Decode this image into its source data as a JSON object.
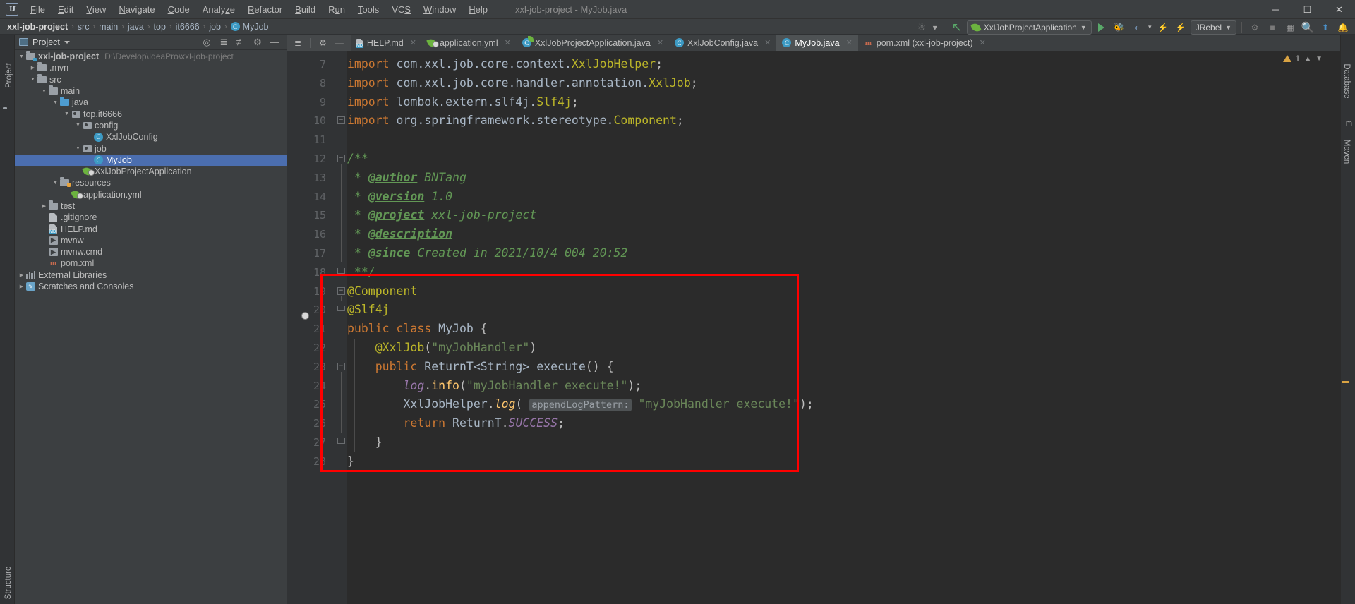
{
  "titlebar": {
    "logo": "IJ",
    "menus": [
      {
        "label": "File",
        "mnemonic": "F"
      },
      {
        "label": "Edit",
        "mnemonic": "E"
      },
      {
        "label": "View",
        "mnemonic": "V"
      },
      {
        "label": "Navigate",
        "mnemonic": "N"
      },
      {
        "label": "Code",
        "mnemonic": "C"
      },
      {
        "label": "Analyze",
        "mnemonic": "z"
      },
      {
        "label": "Refactor",
        "mnemonic": "R"
      },
      {
        "label": "Build",
        "mnemonic": "B"
      },
      {
        "label": "Run",
        "mnemonic": "u"
      },
      {
        "label": "Tools",
        "mnemonic": "T"
      },
      {
        "label": "VCS",
        "mnemonic": "S"
      },
      {
        "label": "Window",
        "mnemonic": "W"
      },
      {
        "label": "Help",
        "mnemonic": "H"
      }
    ],
    "window_title": "xxl-job-project - MyJob.java",
    "minimize": "─",
    "maximize": "☐",
    "close": "✕"
  },
  "breadcrumb": {
    "items": [
      "xxl-job-project",
      "src",
      "main",
      "java",
      "top",
      "it6666",
      "job",
      "MyJob"
    ],
    "separator": "›",
    "class_badge": "C"
  },
  "toolbar": {
    "run_config": "XxlJobProjectApplication",
    "jrebel": "JRebel",
    "dropdown_arrow": "▼",
    "icons": [
      "user-avatar-icon",
      "update-project-icon",
      "run-icon",
      "debug-icon",
      "coverage-icon",
      "profile-icon",
      "build-icon",
      "stop-icon",
      "search-everywhere-icon",
      "settings-icon",
      "notifications-icon"
    ]
  },
  "left_strip": {
    "project_label": "Project",
    "structure_label": "Structure"
  },
  "right_strip": {
    "database_label": "Database",
    "maven_label": "Maven"
  },
  "project_panel": {
    "title": "Project",
    "caret": "▼",
    "actions": [
      "locate-icon",
      "collapse-all-icon",
      "expand-icon",
      "settings-icon",
      "hide-icon"
    ],
    "tree": [
      {
        "indent": 0,
        "arrow": "down",
        "icon": "module-folder",
        "label": "xxl-job-project",
        "path": "D:\\Develop\\IdeaPro\\xxl-job-project",
        "bold": true,
        "selected": false
      },
      {
        "indent": 1,
        "arrow": "right",
        "icon": "folder",
        "label": ".mvn",
        "path": "",
        "bold": false,
        "selected": false
      },
      {
        "indent": 1,
        "arrow": "down",
        "icon": "folder",
        "label": "src",
        "path": "",
        "bold": false,
        "selected": false
      },
      {
        "indent": 2,
        "arrow": "down",
        "icon": "folder",
        "label": "main",
        "path": "",
        "bold": false,
        "selected": false
      },
      {
        "indent": 3,
        "arrow": "down",
        "icon": "folder-source",
        "label": "java",
        "path": "",
        "bold": false,
        "selected": false
      },
      {
        "indent": 4,
        "arrow": "down",
        "icon": "package",
        "label": "top.it6666",
        "path": "",
        "bold": false,
        "selected": false
      },
      {
        "indent": 5,
        "arrow": "down",
        "icon": "package",
        "label": "config",
        "path": "",
        "bold": false,
        "selected": false
      },
      {
        "indent": 6,
        "arrow": "none",
        "icon": "java-class",
        "label": "XxlJobConfig",
        "path": "",
        "bold": false,
        "selected": false
      },
      {
        "indent": 5,
        "arrow": "down",
        "icon": "package",
        "label": "job",
        "path": "",
        "bold": false,
        "selected": false
      },
      {
        "indent": 6,
        "arrow": "none",
        "icon": "java-class",
        "label": "MyJob",
        "path": "",
        "bold": false,
        "selected": true
      },
      {
        "indent": 5,
        "arrow": "none",
        "icon": "spring-boot",
        "label": "XxlJobProjectApplication",
        "path": "",
        "bold": false,
        "selected": false
      },
      {
        "indent": 3,
        "arrow": "down",
        "icon": "folder-resources",
        "label": "resources",
        "path": "",
        "bold": false,
        "selected": false
      },
      {
        "indent": 4,
        "arrow": "none",
        "icon": "spring-yaml",
        "label": "application.yml",
        "path": "",
        "bold": false,
        "selected": false
      },
      {
        "indent": 2,
        "arrow": "right",
        "icon": "folder",
        "label": "test",
        "path": "",
        "bold": false,
        "selected": false
      },
      {
        "indent": 2,
        "arrow": "none",
        "icon": "gitignore",
        "label": ".gitignore",
        "path": "",
        "bold": false,
        "selected": false
      },
      {
        "indent": 2,
        "arrow": "none",
        "icon": "markdown",
        "label": "HELP.md",
        "path": "",
        "bold": false,
        "selected": false
      },
      {
        "indent": 2,
        "arrow": "none",
        "icon": "shell-script",
        "label": "mvnw",
        "path": "",
        "bold": false,
        "selected": false
      },
      {
        "indent": 2,
        "arrow": "none",
        "icon": "shell-script",
        "label": "mvnw.cmd",
        "path": "",
        "bold": false,
        "selected": false
      },
      {
        "indent": 2,
        "arrow": "none",
        "icon": "maven-pom",
        "label": "pom.xml",
        "path": "",
        "bold": false,
        "selected": false
      },
      {
        "indent": 0,
        "arrow": "right",
        "icon": "libraries",
        "label": "External Libraries",
        "path": "",
        "bold": false,
        "selected": false
      },
      {
        "indent": 0,
        "arrow": "right",
        "icon": "scratches",
        "label": "Scratches and Consoles",
        "path": "",
        "bold": false,
        "selected": false
      }
    ]
  },
  "tabs": [
    {
      "label": "HELP.md",
      "icon": "markdown-icon",
      "active": false,
      "close": "✕"
    },
    {
      "label": "application.yml",
      "icon": "spring-yaml-icon",
      "active": false,
      "close": "✕"
    },
    {
      "label": "XxlJobProjectApplication.java",
      "icon": "spring-class-icon",
      "active": false,
      "close": "✕"
    },
    {
      "label": "XxlJobConfig.java",
      "icon": "java-class-icon",
      "active": false,
      "close": "✕"
    },
    {
      "label": "MyJob.java",
      "icon": "java-class-icon",
      "active": true,
      "close": "✕"
    },
    {
      "label": "pom.xml (xxl-job-project)",
      "icon": "maven-icon",
      "active": false,
      "close": "✕"
    }
  ],
  "editor": {
    "warning_count": "1",
    "first_line_number": 7,
    "lines": [
      {
        "n": 7,
        "text": "import com.xxl.job.core.context.XxlJobHelper;"
      },
      {
        "n": 8,
        "text": "import com.xxl.job.core.handler.annotation.XxlJob;"
      },
      {
        "n": 9,
        "text": "import lombok.extern.slf4j.Slf4j;"
      },
      {
        "n": 10,
        "text": "import org.springframework.stereotype.Component;"
      },
      {
        "n": 11,
        "text": ""
      },
      {
        "n": 12,
        "text": "/**"
      },
      {
        "n": 13,
        "text": " * @author BNTang"
      },
      {
        "n": 14,
        "text": " * @version 1.0"
      },
      {
        "n": 15,
        "text": " * @project xxl-job-project"
      },
      {
        "n": 16,
        "text": " * @description"
      },
      {
        "n": 17,
        "text": " * @since Created in 2021/10/4 004 20:52"
      },
      {
        "n": 18,
        "text": " **/"
      },
      {
        "n": 19,
        "text": "@Component"
      },
      {
        "n": 20,
        "text": "@Slf4j"
      },
      {
        "n": 21,
        "text": "public class MyJob {"
      },
      {
        "n": 22,
        "text": "    @XxlJob(\"myJobHandler\")"
      },
      {
        "n": 23,
        "text": "    public ReturnT<String> execute() {"
      },
      {
        "n": 24,
        "text": "        log.info(\"myJobHandler execute!\");"
      },
      {
        "n": 25,
        "text": "        XxlJobHelper.log( appendLogPattern: \"myJobHandler execute!\");"
      },
      {
        "n": 26,
        "text": "        return ReturnT.SUCCESS;"
      },
      {
        "n": 27,
        "text": "    }"
      },
      {
        "n": 28,
        "text": "}"
      }
    ],
    "param_hint": "appendLogPattern:"
  },
  "colors": {
    "accent_red": "#ff0000",
    "selection_blue": "#4b6eaf",
    "keyword_orange": "#cc7832",
    "string_green": "#6a8759",
    "comment_green": "#629755",
    "annotation_yellow": "#bbb529",
    "method_yellow": "#ffc66d",
    "field_purple": "#9876aa",
    "editor_bg": "#2b2b2b",
    "panel_bg": "#3c3f41"
  }
}
